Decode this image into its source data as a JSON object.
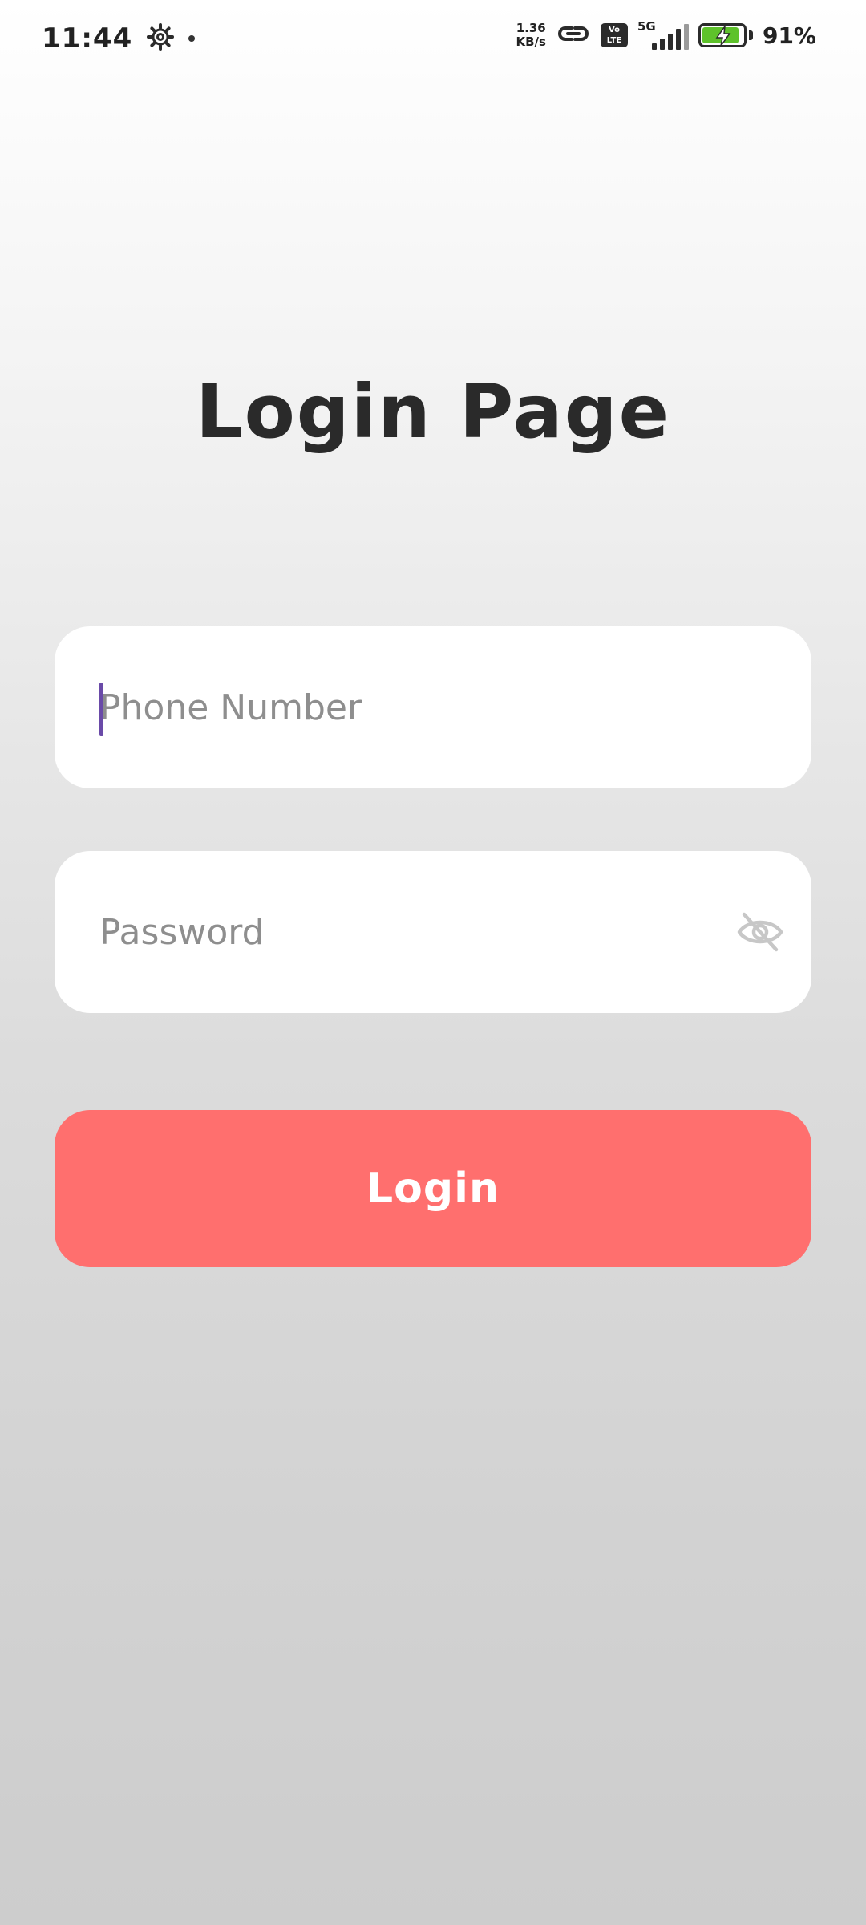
{
  "status_bar": {
    "time": "11:44",
    "speed_value": "1.36",
    "speed_unit": "KB/s",
    "volte_top": "Vo",
    "volte_bottom": "LTE",
    "network": "5G",
    "battery_level": 0.91,
    "battery_percent": "91%",
    "battery_color": "#5ec22b"
  },
  "page": {
    "title": "Login Page"
  },
  "form": {
    "phone_placeholder": "Phone Number",
    "phone_value": "",
    "password_placeholder": "Password",
    "password_value": "",
    "login_label": "Login"
  },
  "colors": {
    "accent": "#ff6f6e",
    "caret": "#6a4aa8",
    "placeholder": "#8e8e8e"
  },
  "icons": {
    "settings": "gear-icon",
    "link": "link-icon",
    "password_toggle": "eye-off-icon",
    "charging": "lightning-icon"
  }
}
